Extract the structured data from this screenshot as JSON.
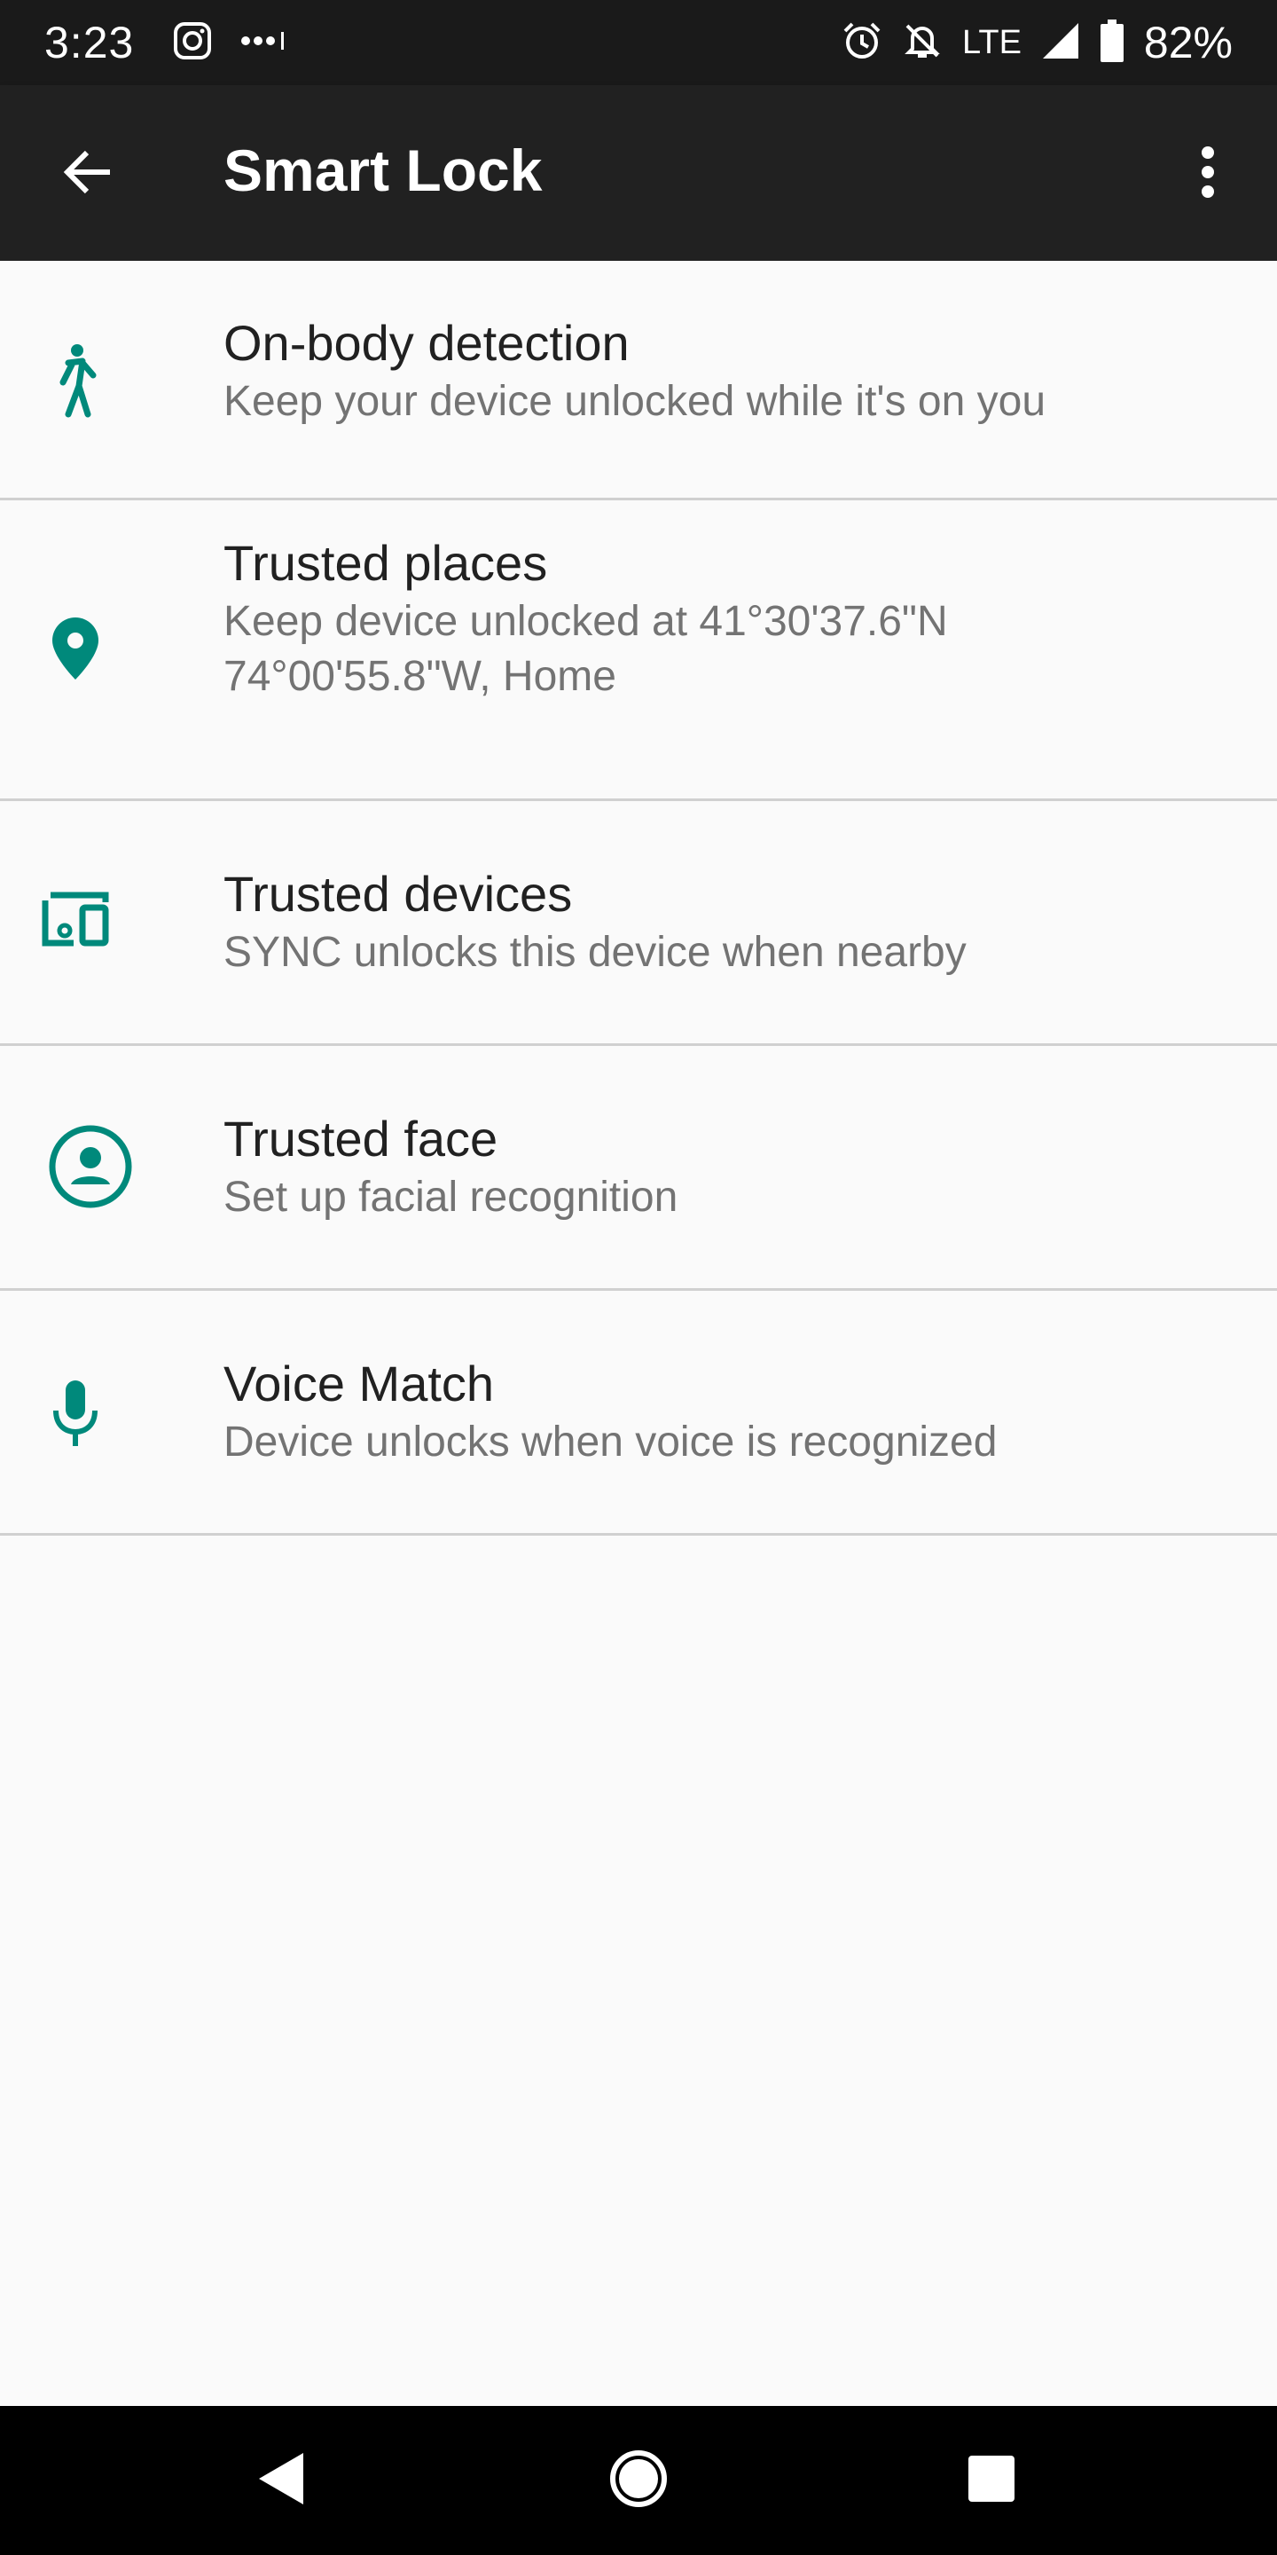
{
  "status_bar": {
    "time": "3:23",
    "network": "LTE",
    "battery": "82%",
    "icons": [
      "instagram-icon",
      "more-dots-icon",
      "alarm-icon",
      "notifications-off-icon",
      "signal-icon",
      "battery-icon"
    ]
  },
  "app_bar": {
    "title": "Smart Lock",
    "back_icon": "arrow-back-icon",
    "menu_icon": "more-vert-icon"
  },
  "items": [
    {
      "title": "On-body detection",
      "subtitle": "Keep your device unlocked while it's on you",
      "icon": "walk-icon"
    },
    {
      "title": "Trusted places",
      "subtitle": "Keep device unlocked at 41°30'37.6\"N 74°00'55.8\"W, Home",
      "icon": "location-pin-icon"
    },
    {
      "title": "Trusted devices",
      "subtitle": "SYNC unlocks this device when nearby",
      "icon": "devices-icon"
    },
    {
      "title": "Trusted face",
      "subtitle": "Set up facial recognition",
      "icon": "face-icon"
    },
    {
      "title": "Voice Match",
      "subtitle": "Device unlocks when voice is recognized",
      "icon": "mic-icon"
    }
  ],
  "nav_bar": {
    "icons": [
      "back-triangle-icon",
      "home-circle-icon",
      "recents-square-icon"
    ]
  },
  "colors": {
    "accent": "#00897b",
    "status_bar": "#1a1a1a",
    "app_bar": "#212121",
    "background": "#fafafa",
    "divider": "#d0d0d0",
    "title_text": "#212121",
    "subtitle_text": "#737373"
  }
}
